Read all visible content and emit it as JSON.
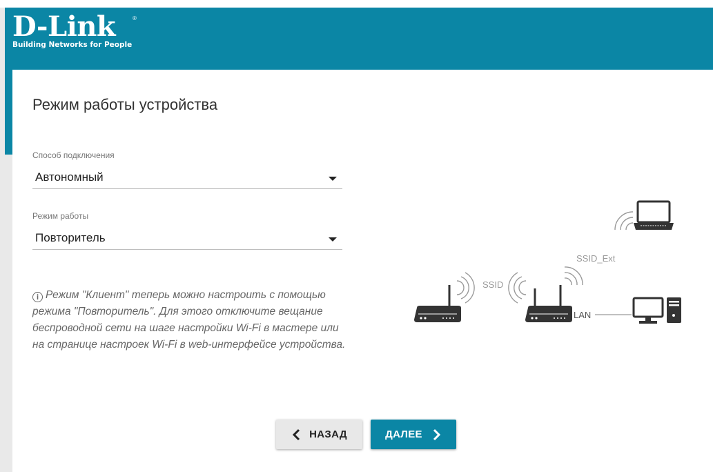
{
  "brand": {
    "name": "D-Link",
    "tagline": "Building Networks for People",
    "registered": "®"
  },
  "page": {
    "title": "Режим работы устройства"
  },
  "form": {
    "connection_method": {
      "label": "Способ подключения",
      "value": "Автономный"
    },
    "work_mode": {
      "label": "Режим работы",
      "value": "Повторитель"
    }
  },
  "info": {
    "icon": "info-icon",
    "text": "Режим \"Клиент\" теперь можно настроить с помощью режима \"Повторитель\". Для этого отключите вещание беспроводной сети на шаге настройки Wi-Fi в мастере или на странице настроек Wi-Fi в web-интерфейсе устройства."
  },
  "diagram": {
    "ssid_label": "SSID",
    "ssid_ext_label": "SSID_Ext",
    "lan_label": "LAN"
  },
  "buttons": {
    "back_label": "НАЗАД",
    "next_label": "ДАЛЕЕ"
  },
  "colors": {
    "brand": "#0b86a5",
    "background": "#e9e9e9",
    "panel": "#ffffff"
  }
}
